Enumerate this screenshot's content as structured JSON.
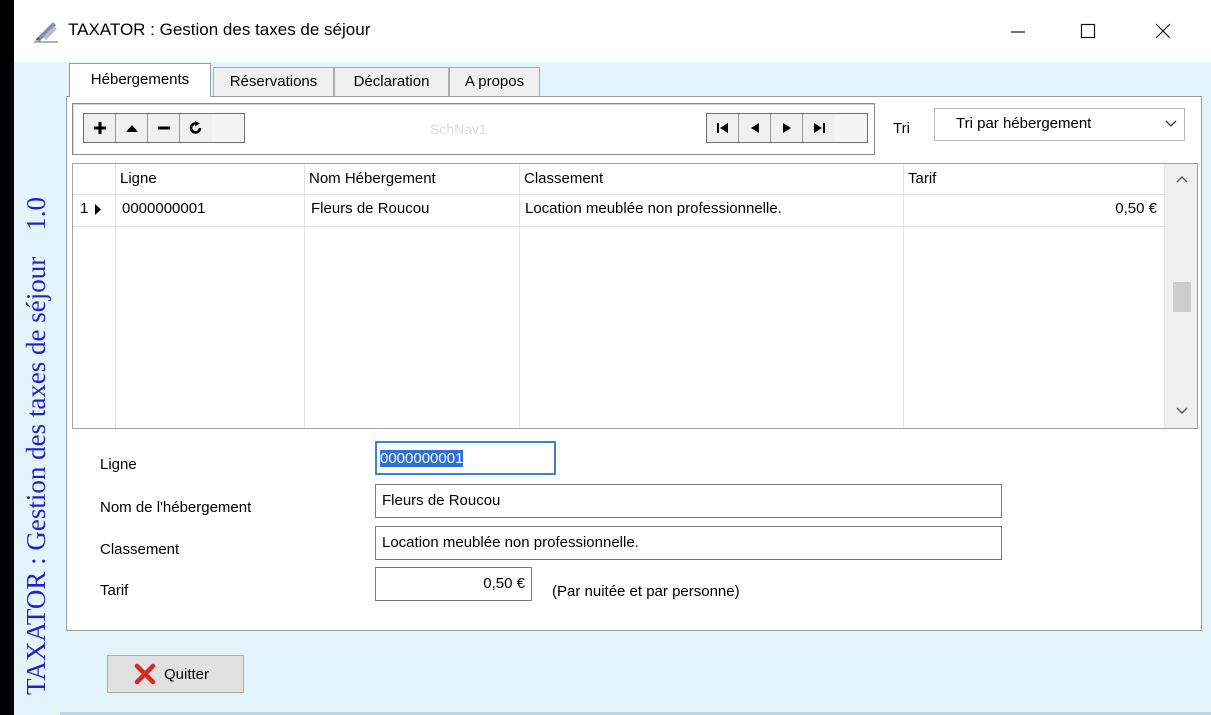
{
  "window": {
    "title": "TAXATOR : Gestion des taxes de séjour",
    "banner": "TAXATOR : Gestion des taxes de séjour",
    "version": "1.0",
    "icons": {
      "app": "brush-pen-icon",
      "minimize": "minimize-icon",
      "maximize": "maximize-icon",
      "close": "close-icon"
    }
  },
  "tabs": [
    {
      "label": "Hébergements",
      "active": true
    },
    {
      "label": "Réservations",
      "active": false
    },
    {
      "label": "Déclaration",
      "active": false
    },
    {
      "label": "A propos",
      "active": false
    }
  ],
  "navigator": {
    "name": "SchNav1",
    "left_buttons": [
      "insert-plus-icon",
      "move-up-icon",
      "delete-minus-icon",
      "refresh-icon"
    ],
    "right_buttons": [
      "first-record-icon",
      "prior-record-icon",
      "next-record-icon",
      "last-record-icon"
    ]
  },
  "sort": {
    "label": "Tri",
    "value": "Tri par hébergement"
  },
  "grid": {
    "columns": [
      "Ligne",
      "Nom Hébergement",
      "Classement",
      "Tarif"
    ],
    "rows": [
      {
        "num": "1",
        "ligne": "0000000001",
        "nom": "Fleurs de Roucou",
        "classement": "Location meublée non professionnelle.",
        "tarif": "0,50 €"
      }
    ]
  },
  "form": {
    "ligne_label": "Ligne",
    "ligne_value": "0000000001",
    "nom_label": "Nom de l'hébergement",
    "nom_value": "Fleurs de Roucou",
    "classement_label": "Classement",
    "classement_value": "Location meublée non professionnelle.",
    "tarif_label": "Tarif",
    "tarif_value": "0,50 €",
    "tarif_note": "(Par nuitée et par personne)"
  },
  "footer": {
    "quit_label": "Quitter",
    "quit_icon": "red-x-icon"
  },
  "colors": {
    "banner_bg": "#e3f4fb",
    "banner_text": "#1f23c7",
    "selection": "#2f6fd6",
    "focus_border": "#3a83d1"
  }
}
